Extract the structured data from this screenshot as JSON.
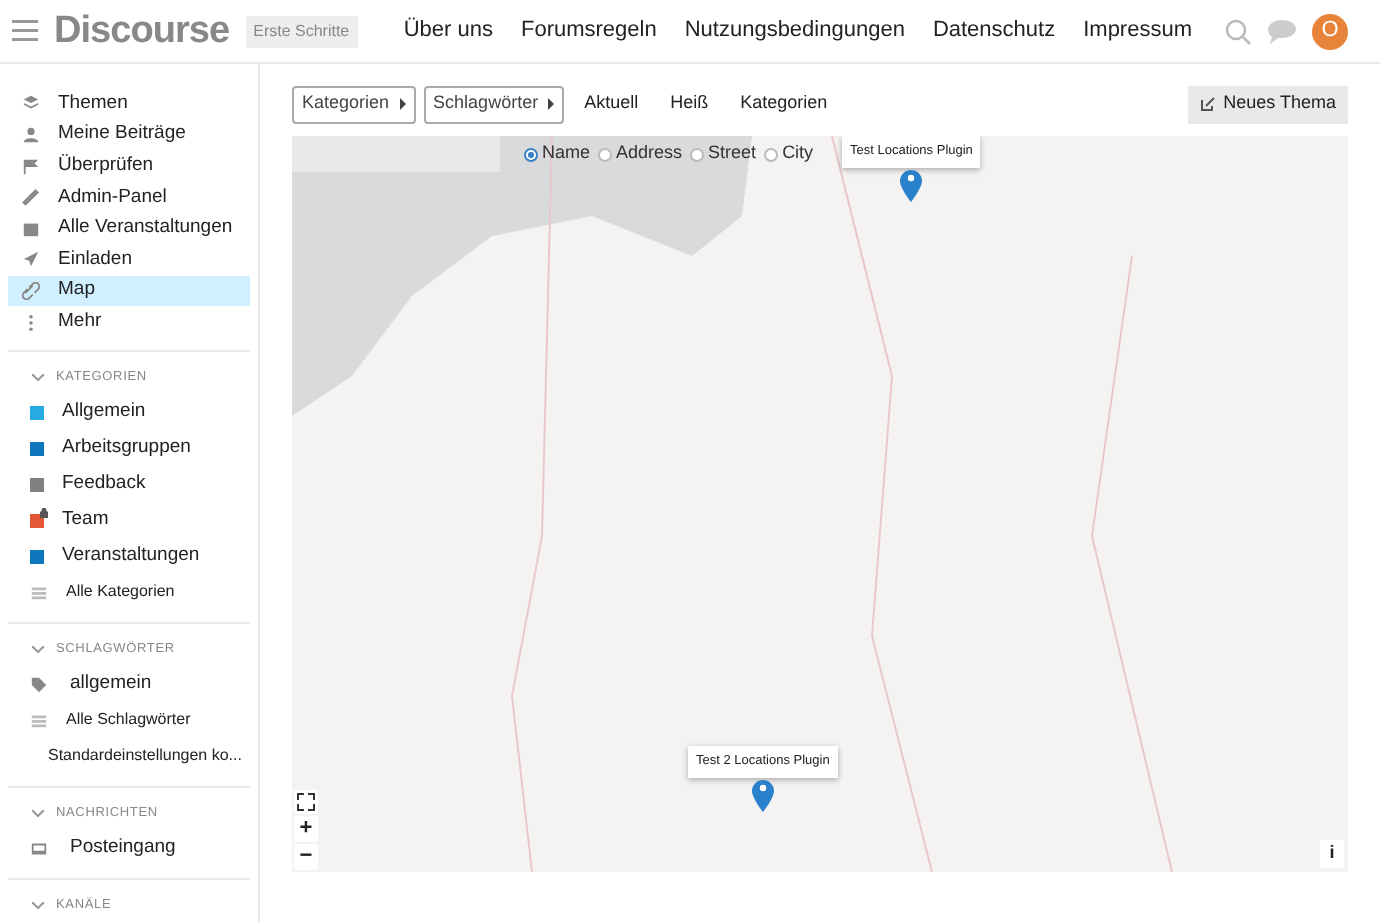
{
  "header": {
    "logo": "Discourse",
    "tagline": "Erste Schritte",
    "nav": [
      "Über uns",
      "Forumsregeln",
      "Nutzungsbedingungen",
      "Datenschutz",
      "Impressum"
    ],
    "avatar": "O"
  },
  "sidebar": {
    "items": [
      {
        "label": "Themen",
        "selected": false
      },
      {
        "label": "Meine Beiträge",
        "selected": false
      },
      {
        "label": "Überprüfen",
        "selected": false
      },
      {
        "label": "Admin-Panel",
        "selected": false
      },
      {
        "label": "Alle Veranstaltungen",
        "selected": false
      },
      {
        "label": "Einladen",
        "selected": false
      },
      {
        "label": "Map",
        "selected": true
      },
      {
        "label": "Mehr",
        "selected": false
      }
    ],
    "sections": [
      {
        "title": "KATEGORIEN",
        "expanded": true,
        "items": [
          {
            "kind": "category",
            "label": "Allgemein",
            "color": "#25aae1",
            "locked": false
          },
          {
            "kind": "category",
            "label": "Arbeitsgruppen",
            "color": "#0e76bd",
            "locked": false
          },
          {
            "kind": "category",
            "label": "Feedback",
            "color": "#808281",
            "locked": false
          },
          {
            "kind": "category",
            "label": "Team",
            "color": "#e45735",
            "locked": true
          },
          {
            "kind": "category",
            "label": "Veranstaltungen",
            "color": "#0e76bd",
            "locked": false
          },
          {
            "kind": "link",
            "label": "Alle Kategorien"
          }
        ]
      },
      {
        "title": "SCHLAGWÖRTER",
        "expanded": true,
        "items": [
          {
            "kind": "tag",
            "label": "allgemein"
          },
          {
            "kind": "link",
            "label": "Alle Schlagwörter"
          },
          {
            "kind": "link",
            "label": "Standardeinstellungen ko..."
          }
        ]
      },
      {
        "title": "NACHRICHTEN",
        "expanded": true,
        "items": [
          {
            "kind": "tag",
            "label": "Posteingang"
          }
        ]
      },
      {
        "title": "KANÄLE",
        "expanded": true
      }
    ]
  },
  "toolbar": {
    "dropdowns": [
      "Kategorien",
      "Schlagwörter"
    ],
    "tabs": [
      {
        "label": "Aktuell",
        "selected": false
      },
      {
        "label": "Heiß",
        "selected": false
      },
      {
        "label": "Kategorien",
        "selected": false
      }
    ],
    "new_topic": "Neues Thema"
  },
  "map": {
    "radios": [
      {
        "label": "Name",
        "selected": true
      },
      {
        "label": "Address",
        "selected": false
      },
      {
        "label": "Street",
        "selected": false
      },
      {
        "label": "City",
        "selected": false
      }
    ],
    "markers": [
      "Test Locations Plugin",
      "Test 2 Locations Plugin"
    ],
    "zoom_in": "+",
    "zoom_out": "−",
    "info": "i"
  }
}
